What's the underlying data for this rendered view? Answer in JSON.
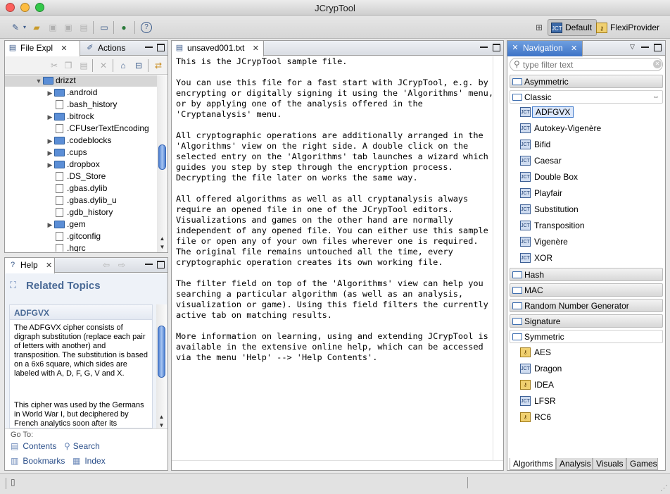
{
  "window": {
    "title": "JCrypTool"
  },
  "perspectives": [
    {
      "label": "Default"
    },
    {
      "label": "FlexiProvider"
    }
  ],
  "left_top_tabs": [
    {
      "label": "File Expl"
    },
    {
      "label": "Actions"
    }
  ],
  "file_tree": {
    "root": "drizzt",
    "items": [
      {
        "name": ".android",
        "kind": "folder"
      },
      {
        "name": ".bash_history",
        "kind": "file"
      },
      {
        "name": ".bitrock",
        "kind": "folder"
      },
      {
        "name": ".CFUserTextEncoding",
        "kind": "file"
      },
      {
        "name": ".codeblocks",
        "kind": "folder"
      },
      {
        "name": ".cups",
        "kind": "folder"
      },
      {
        "name": ".dropbox",
        "kind": "folder"
      },
      {
        "name": ".DS_Store",
        "kind": "file"
      },
      {
        "name": ".gbas.dylib",
        "kind": "file"
      },
      {
        "name": ".gbas.dylib_u",
        "kind": "file"
      },
      {
        "name": ".gdb_history",
        "kind": "file"
      },
      {
        "name": ".gem",
        "kind": "folder"
      },
      {
        "name": ".gitconfig",
        "kind": "file"
      },
      {
        "name": ".hgrc",
        "kind": "file"
      }
    ]
  },
  "help": {
    "tab_label": "Help",
    "related_topics": "Related Topics",
    "topic_title": "ADFGVX",
    "para1": "The ADFGVX cipher consists of digraph substitution (replace each pair of letters with another) and transposition. The substitution is based on a 6x6 square, which sides are labeled with A, D, F, G, V and X.",
    "para2": "This cipher was used by the Germans in World War I, but deciphered by French analytics soon after its deployment in the",
    "goto": "Go To:",
    "contents": "Contents",
    "search": "Search",
    "bookmarks": "Bookmarks",
    "index": "Index"
  },
  "editor": {
    "tab_label": "unsaved001.txt",
    "text": "This is the JCrypTool sample file.\n\nYou can use this file for a fast start with JCrypTool, e.g. by\nencrypting or digitally signing it using the 'Algorithms' menu,\nor by applying one of the analysis offered in the\n'Cryptanalysis' menu.\n\nAll cryptographic operations are additionally arranged in the\n'Algorithms' view on the right side. A double click on the\nselected entry on the 'Algorithms' tab launches a wizard which\nguides you step by step through the encryption process.\nDecrypting the file later on works the same way.\n\nAll offered algorithms as well as all cryptanalysis always\nrequire an opened file in one of the JCrypTool editors.\nVisualizations and games on the other hand are normally\nindependent of any opened file. You can either use this sample\nfile or open any of your own files wherever one is required.\nThe original file remains untouched all the time, every\ncryptographic operation creates its own working file.\n\nThe filter field on top of the 'Algorithms' view can help you\nsearching a particular algorithm (as well as an analysis,\nvisualization or game). Using this field filters the currently\nactive tab on matching results.\n\nMore information on learning, using and extending JCrypTool is\navailable in the extensive online help, which can be accessed\nvia the menu 'Help' --> 'Help Contents'."
  },
  "navigation": {
    "tab_label": "Navigation",
    "filter_placeholder": "type filter text",
    "categories": [
      {
        "label": "Asymmetric"
      },
      {
        "label": "Classic"
      },
      {
        "label": "Hash"
      },
      {
        "label": "MAC"
      },
      {
        "label": "Random Number Generator"
      },
      {
        "label": "Signature"
      },
      {
        "label": "Symmetric"
      }
    ],
    "classic_items": [
      "ADFGVX",
      "Autokey-Vigenère",
      "Bifid",
      "Caesar",
      "Double Box",
      "Playfair",
      "Substitution",
      "Transposition",
      "Vigenère",
      "XOR"
    ],
    "symmetric_items": [
      "AES",
      "Dragon",
      "IDEA",
      "LFSR",
      "RC6"
    ],
    "bottom_tabs": [
      {
        "label": "Algorithms"
      },
      {
        "label": "Analysis"
      },
      {
        "label": "Visuals"
      },
      {
        "label": "Games"
      }
    ],
    "icon_label": "JCT"
  }
}
